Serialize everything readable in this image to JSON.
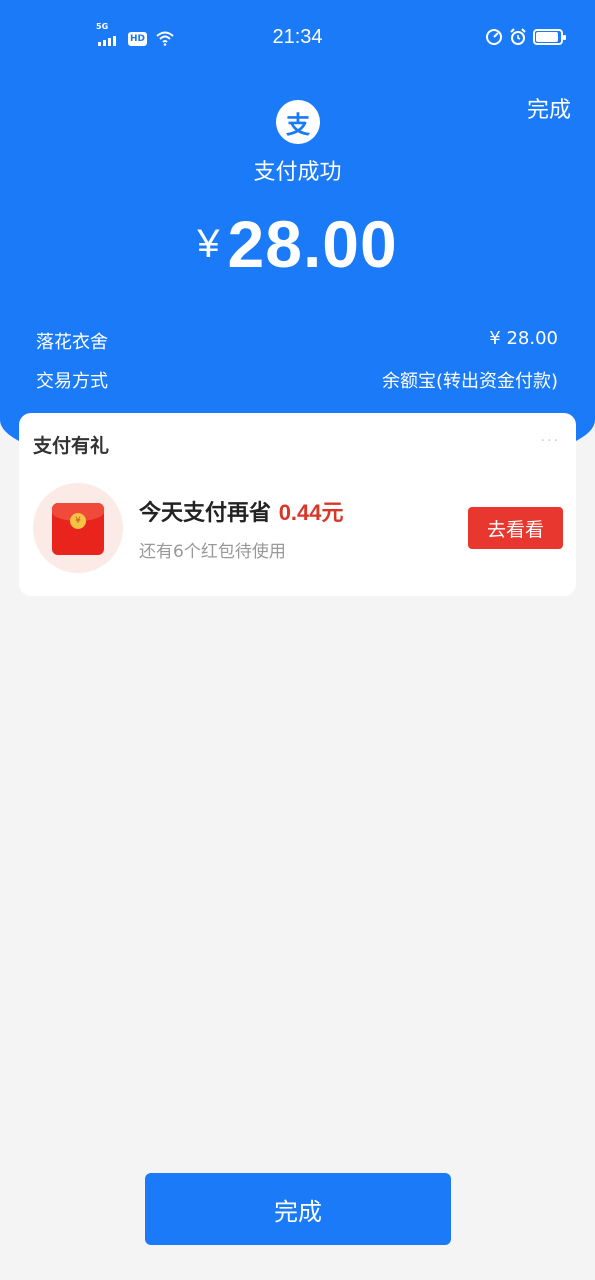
{
  "status_bar": {
    "network": "5G",
    "hd": "HD",
    "time": "21:34",
    "icons": [
      "signal-icon",
      "hd-icon",
      "wifi-icon",
      "speedometer-icon",
      "alarm-icon",
      "battery-icon"
    ]
  },
  "header": {
    "done_label": "完成",
    "logo_char": "支",
    "title": "支付成功",
    "currency": "¥",
    "amount": "28.00"
  },
  "details": [
    {
      "label": "落花衣舍",
      "value": "¥ 28.00"
    },
    {
      "label": "交易方式",
      "value": "余额宝(转出资金付款)"
    }
  ],
  "gift": {
    "title": "支付有礼",
    "more": "···",
    "icon": "red-envelope-icon",
    "seal_char": "¥",
    "main_prefix": "今天支付再省",
    "main_amount": "0.44元",
    "sub": "还有6个红包待使用",
    "button_label": "去看看"
  },
  "footer": {
    "done_label": "完成"
  },
  "colors": {
    "primary": "#1a7af8",
    "accent_red": "#e8372e",
    "background": "#f4f4f4"
  }
}
